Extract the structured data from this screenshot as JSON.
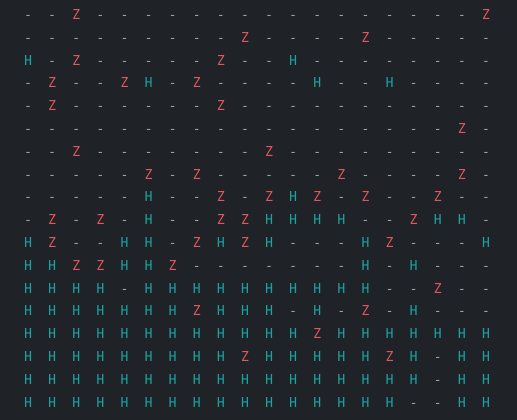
{
  "board": {
    "rows": [
      [
        "-",
        "-",
        "Z",
        "-",
        "-",
        "-",
        "-",
        "-",
        "-",
        "-",
        "-",
        "-",
        "-",
        "-",
        "-",
        "-",
        "-",
        "-",
        "-",
        "Z"
      ],
      [
        "-",
        "-",
        "-",
        "-",
        "-",
        "-",
        "-",
        "-",
        "-",
        "Z",
        "-",
        "-",
        "-",
        "-",
        "Z",
        "-",
        "-",
        "-",
        "-",
        "-"
      ],
      [
        "H",
        "-",
        "Z",
        "-",
        "-",
        "-",
        "-",
        "-",
        "Z",
        "-",
        "-",
        "H",
        "-",
        "-",
        "-",
        "-",
        "-",
        "-",
        "-",
        "-"
      ],
      [
        "-",
        "Z",
        "-",
        "-",
        "Z",
        "H",
        "-",
        "Z",
        "-",
        "-",
        "-",
        "-",
        "H",
        "-",
        "-",
        "H",
        "-",
        "-",
        "-",
        "-"
      ],
      [
        "-",
        "Z",
        "-",
        "-",
        "-",
        "-",
        "-",
        "-",
        "Z",
        "-",
        "-",
        "-",
        "-",
        "-",
        "-",
        "-",
        "-",
        "-",
        "-",
        "-"
      ],
      [
        "-",
        "-",
        "-",
        "-",
        "-",
        "-",
        "-",
        "-",
        "-",
        "-",
        "-",
        "-",
        "-",
        "-",
        "-",
        "-",
        "-",
        "-",
        "Z",
        "-"
      ],
      [
        "-",
        "-",
        "Z",
        "-",
        "-",
        "-",
        "-",
        "-",
        "-",
        "-",
        "Z",
        "-",
        "-",
        "-",
        "-",
        "-",
        "-",
        "-",
        "-",
        "-"
      ],
      [
        "-",
        "-",
        "-",
        "-",
        "-",
        "Z",
        "-",
        "Z",
        "-",
        "-",
        "-",
        "-",
        "-",
        "Z",
        "-",
        "-",
        "-",
        "-",
        "Z",
        "-"
      ],
      [
        "-",
        "-",
        "-",
        "-",
        "-",
        "H",
        "-",
        "-",
        "Z",
        "-",
        "Z",
        "H",
        "Z",
        "-",
        "Z",
        "-",
        "-",
        "Z",
        "-",
        "-"
      ],
      [
        "-",
        "Z",
        "-",
        "Z",
        "-",
        "H",
        "-",
        "-",
        "Z",
        "Z",
        "H",
        "H",
        "H",
        "H",
        "-",
        "-",
        "Z",
        "H",
        "H",
        "-"
      ],
      [
        "H",
        "Z",
        "-",
        "-",
        "H",
        "H",
        "-",
        "Z",
        "H",
        "Z",
        "H",
        "-",
        "-",
        "-",
        "H",
        "Z",
        "-",
        "-",
        "-",
        "H"
      ],
      [
        "H",
        "H",
        "Z",
        "Z",
        "H",
        "H",
        "Z",
        "-",
        "-",
        "-",
        "-",
        "-",
        "-",
        "-",
        "H",
        "-",
        "H",
        "-",
        "-",
        "-"
      ],
      [
        "H",
        "H",
        "H",
        "H",
        "-",
        "H",
        "H",
        "H",
        "H",
        "H",
        "H",
        "H",
        "H",
        "H",
        "H",
        "-",
        "-",
        "Z",
        "-",
        "-"
      ],
      [
        "H",
        "H",
        "H",
        "H",
        "H",
        "H",
        "H",
        "Z",
        "H",
        "H",
        "H",
        "-",
        "H",
        "-",
        "Z",
        "-",
        "H",
        "-",
        "-",
        "-"
      ],
      [
        "H",
        "H",
        "H",
        "H",
        "H",
        "H",
        "H",
        "H",
        "H",
        "H",
        "H",
        "H",
        "Z",
        "H",
        "H",
        "H",
        "H",
        "H",
        "H",
        "H"
      ],
      [
        "H",
        "H",
        "H",
        "H",
        "H",
        "H",
        "H",
        "H",
        "H",
        "Z",
        "H",
        "H",
        "H",
        "H",
        "H",
        "Z",
        "H",
        "-",
        "H",
        "H"
      ],
      [
        "H",
        "H",
        "H",
        "H",
        "H",
        "H",
        "H",
        "H",
        "H",
        "H",
        "H",
        "H",
        "H",
        "H",
        "H",
        "H",
        "H",
        "-",
        "H",
        "H"
      ],
      [
        "H",
        "H",
        "H",
        "H",
        "H",
        "H",
        "H",
        "H",
        "H",
        "H",
        "H",
        "H",
        "H",
        "H",
        "H",
        "H",
        "-",
        "-",
        "H",
        "H"
      ]
    ]
  },
  "legend": {
    "H": "human-cell",
    "Z": "zombie-cell",
    "-": "empty-cell"
  },
  "colors": {
    "background": "#1f2226",
    "empty": "#9ba0a6",
    "human": "#1aa3a3",
    "zombie": "#e4565f"
  }
}
